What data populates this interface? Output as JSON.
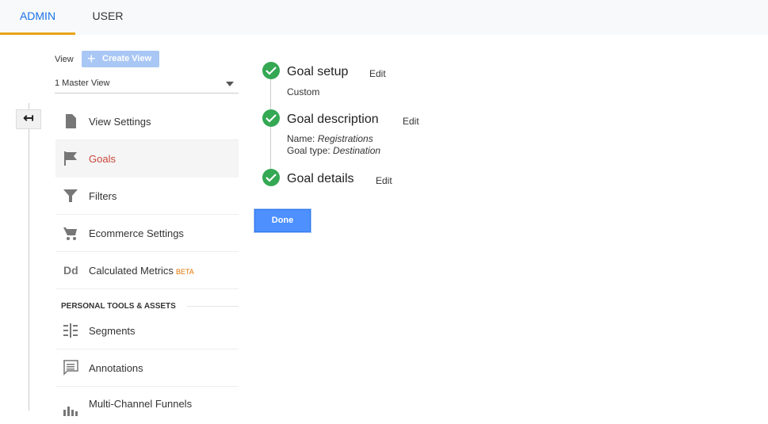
{
  "tabs": [
    {
      "label": "ADMIN",
      "active": true
    },
    {
      "label": "USER",
      "active": false
    }
  ],
  "view": {
    "label": "View",
    "create_button": "Create View",
    "selected": "1 Master View"
  },
  "nav": {
    "items": [
      {
        "label": "View Settings",
        "icon": "document-icon"
      },
      {
        "label": "Goals",
        "icon": "flag-icon",
        "active": true
      },
      {
        "label": "Filters",
        "icon": "filter-icon"
      },
      {
        "label": "Ecommerce Settings",
        "icon": "cart-icon"
      },
      {
        "label": "Calculated Metrics",
        "icon": "dd-icon",
        "badge": "BETA",
        "icon_text": "Dd"
      },
      {
        "label": "Segments",
        "icon": "segments-icon"
      },
      {
        "label": "Annotations",
        "icon": "annotation-icon"
      },
      {
        "label": "Multi-Channel Funnels",
        "icon": "mcf-icon"
      }
    ],
    "section_title": "PERSONAL TOOLS & ASSETS"
  },
  "steps": [
    {
      "title": "Goal setup",
      "edit": "Edit",
      "detail": "Custom"
    },
    {
      "title": "Goal description",
      "edit": "Edit",
      "name_label": "Name:",
      "name_value": "Registrations",
      "type_label": "Goal type:",
      "type_value": "Destination"
    },
    {
      "title": "Goal details",
      "edit": "Edit"
    }
  ],
  "done_button": "Done",
  "colors": {
    "accent": "#1a73e8",
    "active_nav": "#c9473a",
    "check": "#34a853",
    "done": "#4d90fe",
    "tab_underline": "#e8a317",
    "beta": "#e37400"
  }
}
